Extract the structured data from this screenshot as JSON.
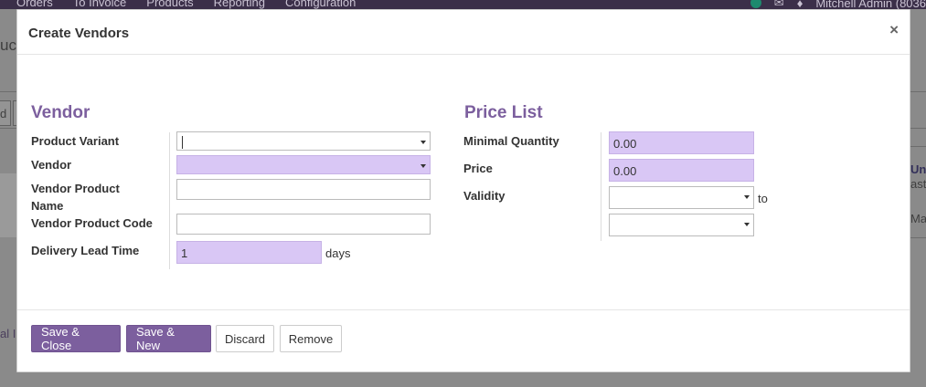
{
  "background": {
    "menu": [
      "Orders",
      "To Invoice",
      "Products",
      "Reporting",
      "Configuration"
    ],
    "user": "Mitchell Admin (8036",
    "left_fragments": [
      "uc",
      "d",
      "al In"
    ],
    "right_fragments": [
      "Un",
      "aste",
      "Ma"
    ]
  },
  "modal": {
    "title": "Create Vendors",
    "close_symbol": "×"
  },
  "vendor_section": {
    "title": "Vendor",
    "fields": {
      "product_variant": {
        "label": "Product Variant",
        "value": ""
      },
      "vendor": {
        "label": "Vendor",
        "value": ""
      },
      "vendor_product_name": {
        "label": "Vendor Product Name",
        "value": ""
      },
      "vendor_product_code": {
        "label": "Vendor Product Code",
        "value": ""
      },
      "delivery_lead_time": {
        "label": "Delivery Lead Time",
        "value": "1",
        "unit": "days"
      }
    }
  },
  "pricelist_section": {
    "title": "Price List",
    "fields": {
      "minimal_quantity": {
        "label": "Minimal Quantity",
        "value": "0.00"
      },
      "price": {
        "label": "Price",
        "value": "0.00"
      },
      "validity": {
        "label": "Validity",
        "from": "",
        "to_label": "to",
        "to": ""
      }
    }
  },
  "footer": {
    "save_close": "Save & Close",
    "save_new": "Save & New",
    "discard": "Discard",
    "remove": "Remove"
  },
  "colors": {
    "accent": "#7C5F9E",
    "required_field": "#D9C7F5"
  }
}
